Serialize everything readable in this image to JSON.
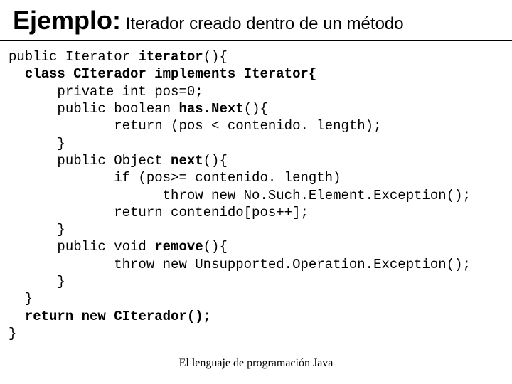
{
  "title": {
    "main": "Ejemplo:",
    "sub": " Iterador creado dentro de un método"
  },
  "code": {
    "l1a": "public Iterator ",
    "l1b": "iterator",
    "l1c": "(){",
    "l2a": "  ",
    "l2b": "class CIterador implements Iterator{",
    "l3": "      private int pos=0;",
    "l4a": "      public boolean ",
    "l4b": "has.Next",
    "l4c": "(){",
    "l5": "             return (pos < contenido. length);",
    "l6": "      }",
    "l7a": "      public Object ",
    "l7b": "next",
    "l7c": "(){",
    "l8": "             if (pos>= contenido. length)",
    "l9": "                   throw new No.Such.Element.Exception();",
    "l10": "             return contenido[pos++];",
    "l11": "      }",
    "l12a": "      public void ",
    "l12b": "remove",
    "l12c": "(){",
    "l13": "             throw new Unsupported.Operation.Exception();",
    "l14": "      }",
    "l15": "  }",
    "l16a": "  ",
    "l16b": "return new CIterador();",
    "l17": "}"
  },
  "footer": "El lenguaje de programación Java"
}
